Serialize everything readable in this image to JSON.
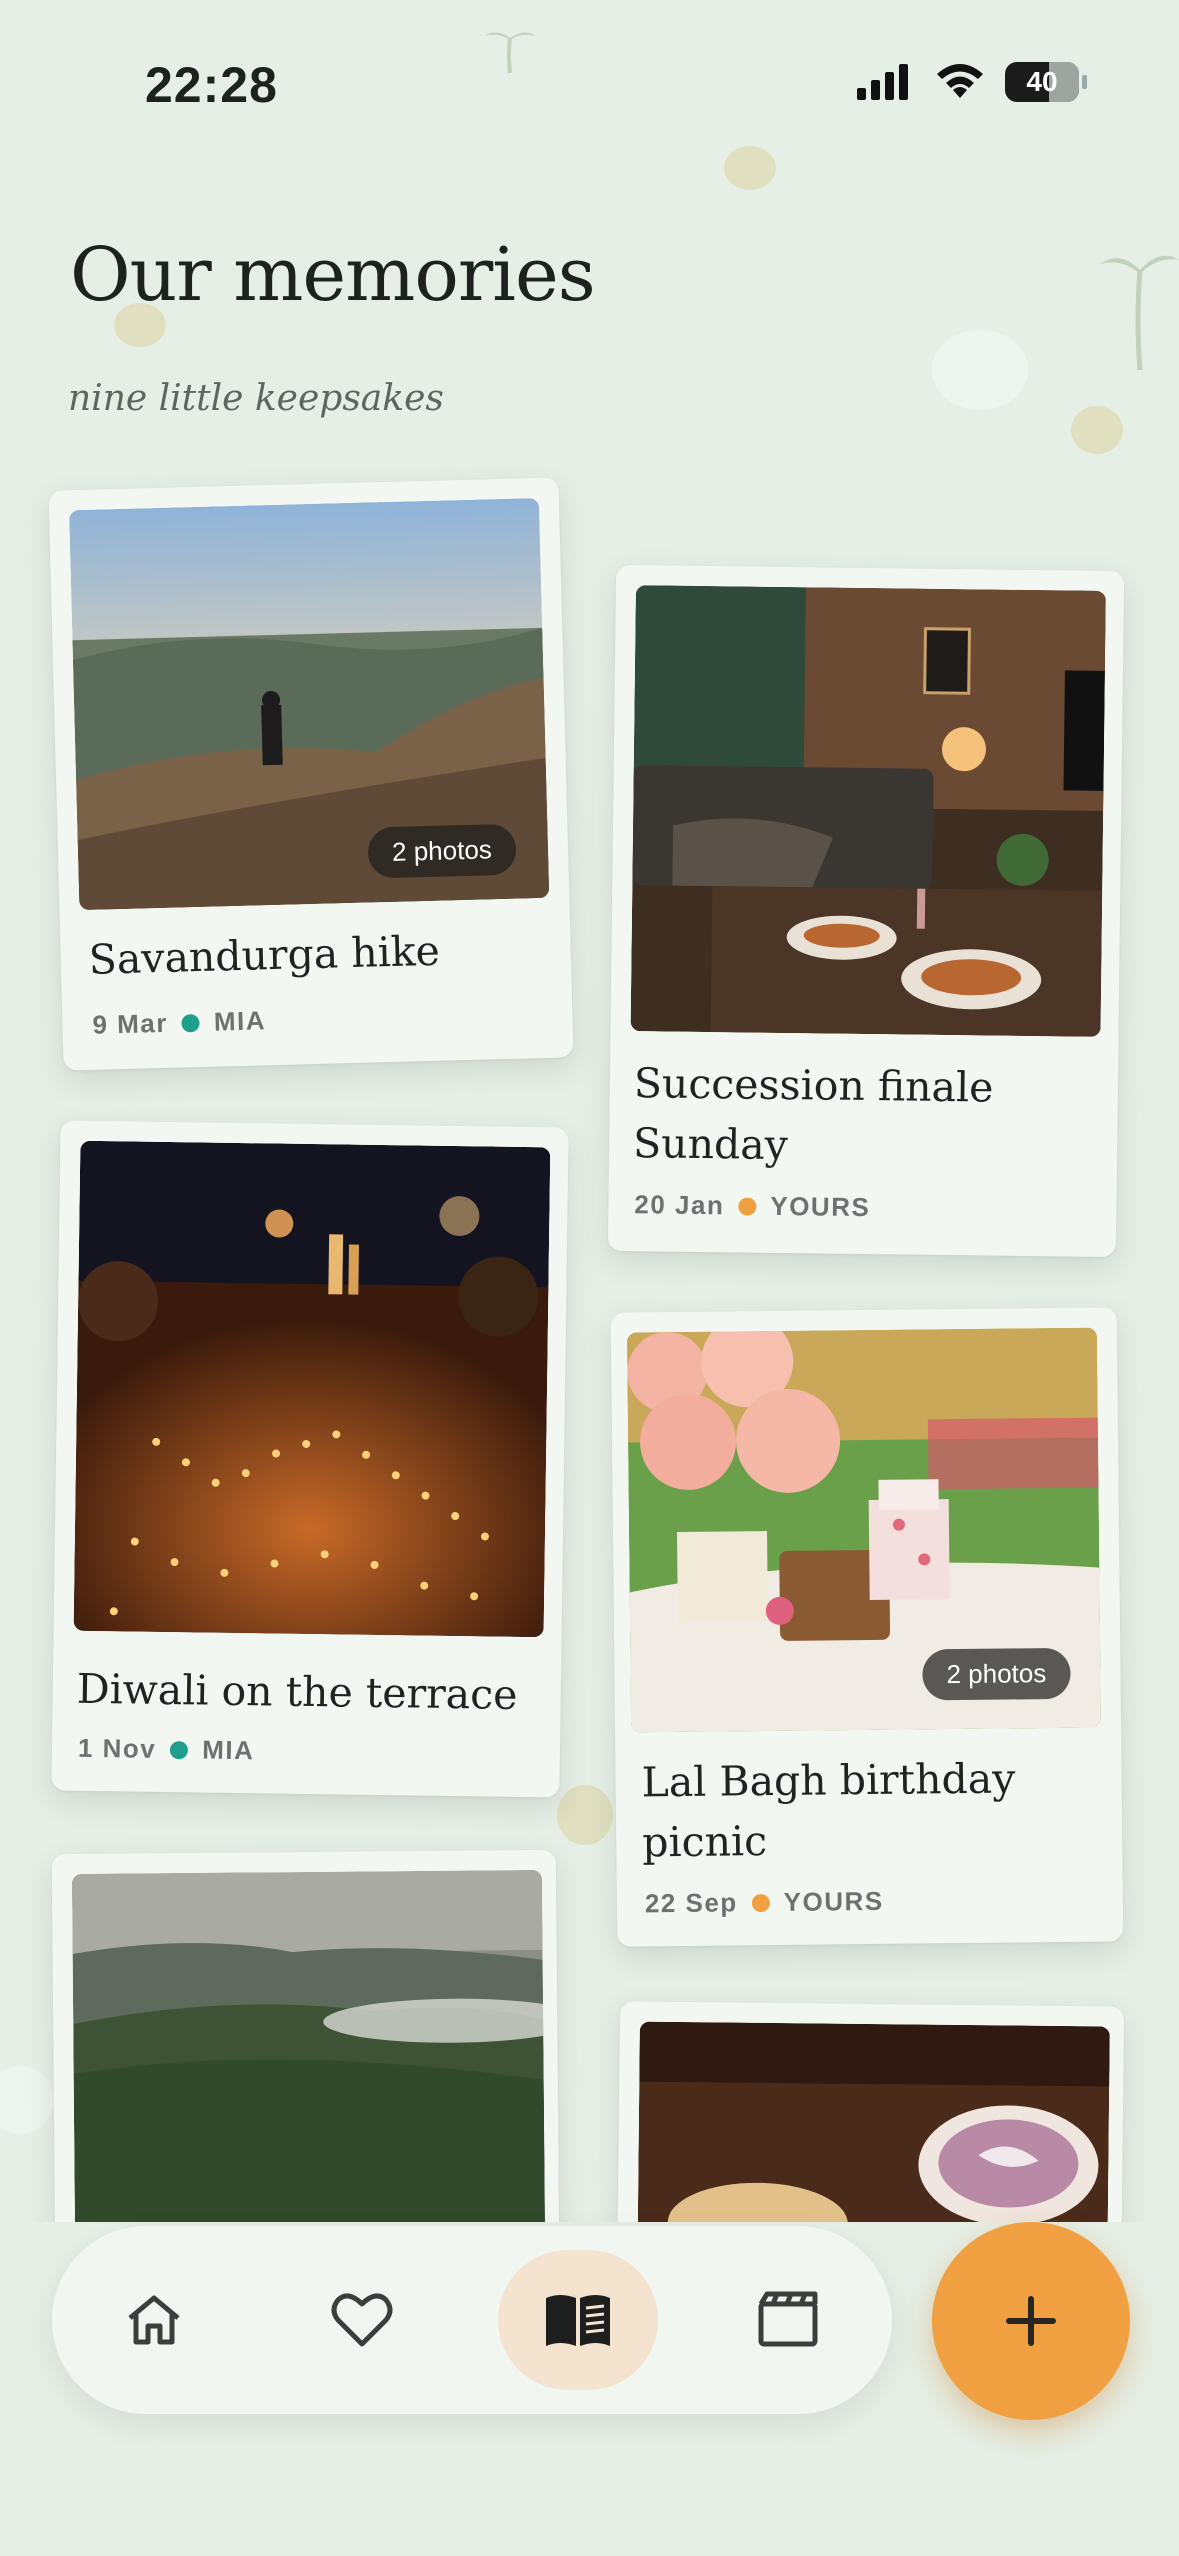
{
  "status": {
    "time": "22:28",
    "battery": "40"
  },
  "header": {
    "title": "Our memories",
    "subtitle": "nine little keepsakes"
  },
  "colors": {
    "mia_dot": "#1f9e8c",
    "yours_dot": "#f0a040",
    "accent": "#f0a040"
  },
  "cards": [
    {
      "title": "Savandurga hike",
      "date": "9 Mar",
      "author": "MIA",
      "badge": "2 photos"
    },
    {
      "title_line1": "Succession finale",
      "title_line2": "Sunday",
      "date": "20 Jan",
      "author": "YOURS"
    },
    {
      "title": "Diwali on the terrace",
      "date": "1 Nov",
      "author": "MIA"
    },
    {
      "title_line1": "Lal Bagh birthday",
      "title_line2": "picnic",
      "date": "22 Sep",
      "author": "YOURS",
      "badge": "2 photos"
    }
  ],
  "nav": {
    "items": [
      "home-icon",
      "heart-icon",
      "book-icon",
      "clapperboard-icon"
    ],
    "active": "book-icon",
    "fab": "plus-icon"
  }
}
